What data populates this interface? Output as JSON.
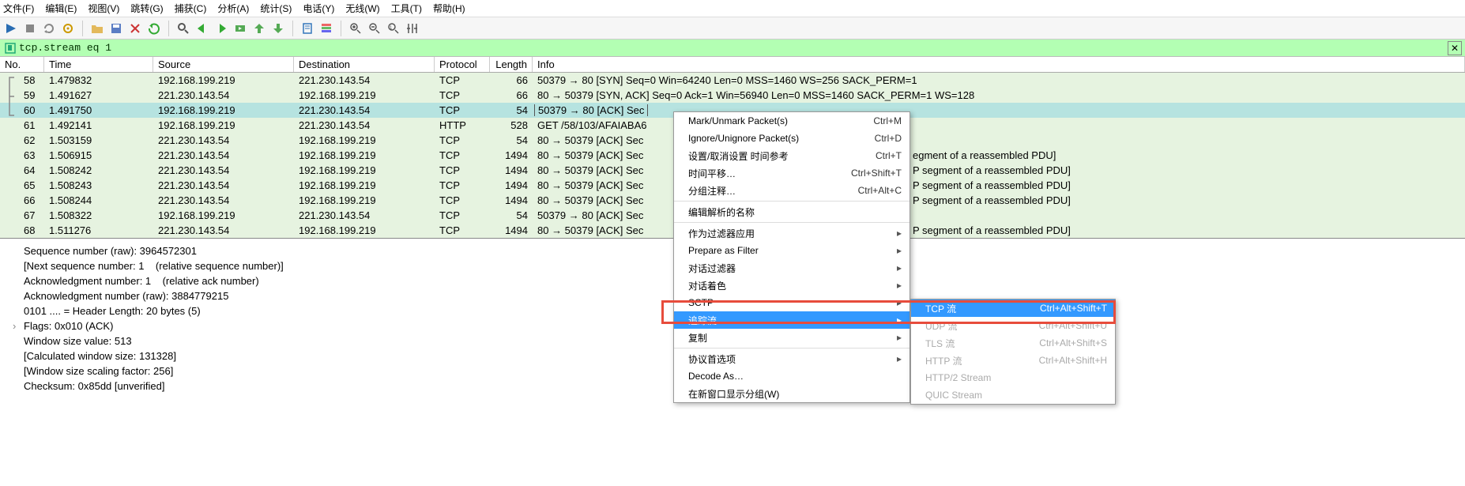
{
  "menubar": {
    "file": "文件(F)",
    "edit": "编辑(E)",
    "view": "视图(V)",
    "go": "跳转(G)",
    "capture": "捕获(C)",
    "analyze": "分析(A)",
    "statistics": "统计(S)",
    "telephony": "电话(Y)",
    "wireless": "无线(W)",
    "tools": "工具(T)",
    "help": "帮助(H)"
  },
  "filter": {
    "text": "tcp.stream eq 1"
  },
  "columns": {
    "no": "No.",
    "time": "Time",
    "source": "Source",
    "destination": "Destination",
    "protocol": "Protocol",
    "length": "Length",
    "info": "Info"
  },
  "rows": [
    {
      "no": "58",
      "time": "1.479832",
      "src": "192.168.199.219",
      "dst": "221.230.143.54",
      "proto": "TCP",
      "len": "66",
      "info": "50379 → 80 [SYN] Seq=0 Win=64240 Len=0 MSS=1460 WS=256 SACK_PERM=1"
    },
    {
      "no": "59",
      "time": "1.491627",
      "src": "221.230.143.54",
      "dst": "192.168.199.219",
      "proto": "TCP",
      "len": "66",
      "info": "80 → 50379 [SYN, ACK] Seq=0 Ack=1 Win=56940 Len=0 MSS=1460 SACK_PERM=1 WS=128"
    },
    {
      "no": "60",
      "time": "1.491750",
      "src": "192.168.199.219",
      "dst": "221.230.143.54",
      "proto": "TCP",
      "len": "54",
      "info": "50379 → 80 [ACK] Sec",
      "selected": true,
      "boxed": true
    },
    {
      "no": "61",
      "time": "1.492141",
      "src": "192.168.199.219",
      "dst": "221.230.143.54",
      "proto": "HTTP",
      "len": "528",
      "info": "GET /58/103/AFAIABA6"
    },
    {
      "no": "62",
      "time": "1.503159",
      "src": "221.230.143.54",
      "dst": "192.168.199.219",
      "proto": "TCP",
      "len": "54",
      "info": "80 → 50379 [ACK] Sec"
    },
    {
      "no": "63",
      "time": "1.506915",
      "src": "221.230.143.54",
      "dst": "192.168.199.219",
      "proto": "TCP",
      "len": "1494",
      "info": "80 → 50379 [ACK] Sec",
      "tail": "egment of a reassembled PDU]"
    },
    {
      "no": "64",
      "time": "1.508242",
      "src": "221.230.143.54",
      "dst": "192.168.199.219",
      "proto": "TCP",
      "len": "1494",
      "info": "80 → 50379 [ACK] Sec",
      "tail": "P segment of a reassembled PDU]"
    },
    {
      "no": "65",
      "time": "1.508243",
      "src": "221.230.143.54",
      "dst": "192.168.199.219",
      "proto": "TCP",
      "len": "1494",
      "info": "80 → 50379 [ACK] Sec",
      "tail": "P segment of a reassembled PDU]"
    },
    {
      "no": "66",
      "time": "1.508244",
      "src": "221.230.143.54",
      "dst": "192.168.199.219",
      "proto": "TCP",
      "len": "1494",
      "info": "80 → 50379 [ACK] Sec",
      "tail": "P segment of a reassembled PDU]"
    },
    {
      "no": "67",
      "time": "1.508322",
      "src": "192.168.199.219",
      "dst": "221.230.143.54",
      "proto": "TCP",
      "len": "54",
      "info": "50379 → 80 [ACK] Sec"
    },
    {
      "no": "68",
      "time": "1.511276",
      "src": "221.230.143.54",
      "dst": "192.168.199.219",
      "proto": "TCP",
      "len": "1494",
      "info": "80 → 50379 [ACK] Sec",
      "tail": "P segment of a reassembled PDU]"
    }
  ],
  "details": {
    "l0": "Sequence number (raw): 3964572301",
    "l1": "[Next sequence number: 1    (relative sequence number)]",
    "l2": "Acknowledgment number: 1    (relative ack number)",
    "l3": "Acknowledgment number (raw): 3884779215",
    "l4": "0101 .... = Header Length: 20 bytes (5)",
    "l5": "Flags: 0x010 (ACK)",
    "l6": "Window size value: 513",
    "l7": "[Calculated window size: 131328]",
    "l8": "[Window size scaling factor: 256]",
    "l9": "Checksum: 0x85dd [unverified]"
  },
  "ctx": {
    "mark": {
      "lbl": "Mark/Unmark Packet(s)",
      "sc": "Ctrl+M"
    },
    "ignore": {
      "lbl": "Ignore/Unignore Packet(s)",
      "sc": "Ctrl+D"
    },
    "timeref": {
      "lbl": "设置/取消设置 时间参考",
      "sc": "Ctrl+T"
    },
    "timeshift": {
      "lbl": "时间平移…",
      "sc": "Ctrl+Shift+T"
    },
    "comment": {
      "lbl": "分组注释…",
      "sc": "Ctrl+Alt+C"
    },
    "editname": {
      "lbl": "编辑解析的名称"
    },
    "applyfilter": {
      "lbl": "作为过滤器应用"
    },
    "prepare": {
      "lbl": "Prepare as Filter"
    },
    "convfilter": {
      "lbl": "对话过滤器"
    },
    "colorize": {
      "lbl": "对话着色"
    },
    "sctp": {
      "lbl": "SCTP"
    },
    "follow": {
      "lbl": "追踪流"
    },
    "copy": {
      "lbl": "复制"
    },
    "prefs": {
      "lbl": "协议首选项"
    },
    "decode": {
      "lbl": "Decode As…"
    },
    "newwin": {
      "lbl": "在新窗口显示分组(W)"
    }
  },
  "sub": {
    "tcp": {
      "lbl": "TCP 流",
      "sc": "Ctrl+Alt+Shift+T"
    },
    "udp": {
      "lbl": "UDP 流",
      "sc": "Ctrl+Alt+Shift+U"
    },
    "tls": {
      "lbl": "TLS 流",
      "sc": "Ctrl+Alt+Shift+S"
    },
    "http": {
      "lbl": "HTTP 流",
      "sc": "Ctrl+Alt+Shift+H"
    },
    "http2": {
      "lbl": "HTTP/2 Stream"
    },
    "quic": {
      "lbl": "QUIC Stream"
    }
  }
}
